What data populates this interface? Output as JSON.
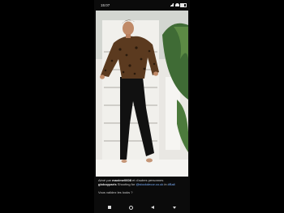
{
  "status_bar": {
    "time": "15:07"
  },
  "post": {
    "liked_by_prefix": "Aimé par ",
    "liked_by_user": "maxime0608",
    "liked_by_suffix": " et d'autres personnes",
    "author": "globoyparis",
    "caption_text": " Shooting for ",
    "mention_1": "@stockdecor.co.uk",
    "caption_in": " in ",
    "mention_2": "#Bali",
    "question": "Vous validez les looks ?"
  },
  "nav": {
    "icons": [
      "recents-icon",
      "home-icon",
      "back-icon",
      "keyboard-hide-icon"
    ]
  },
  "colors": {
    "background": "#000000",
    "link": "#7fb3ff",
    "text": "#cfcfcf"
  }
}
